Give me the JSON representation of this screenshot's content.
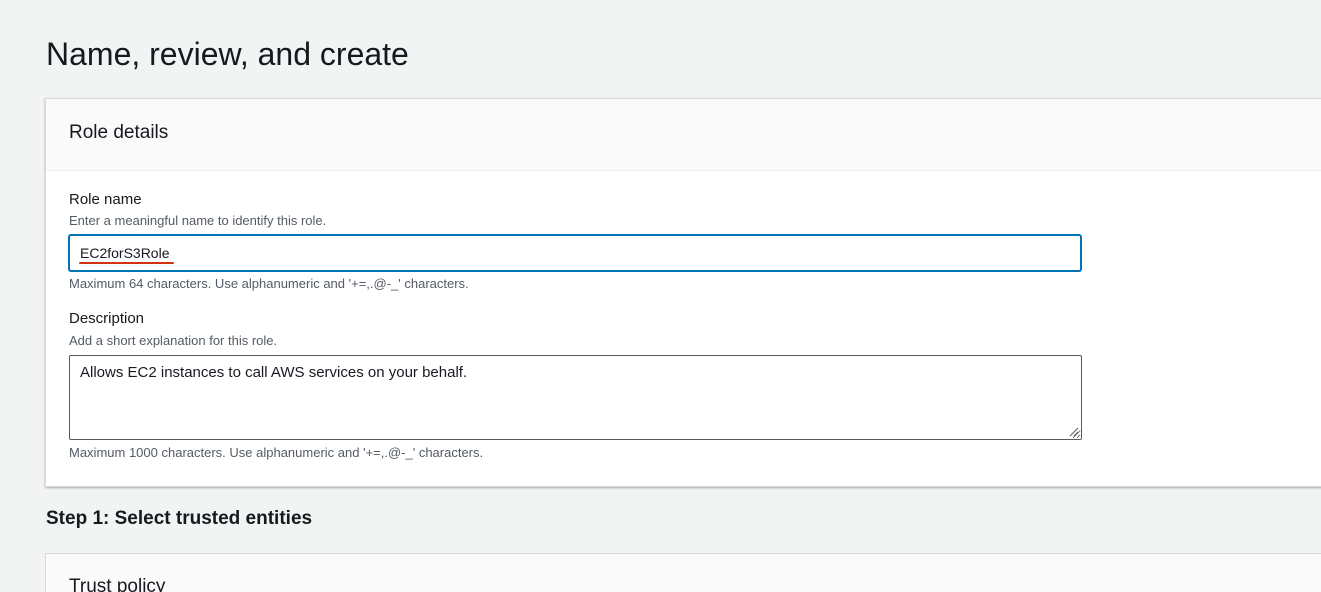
{
  "page": {
    "title": "Name, review, and create"
  },
  "role_details": {
    "header": "Role details",
    "role_name": {
      "label": "Role name",
      "description": "Enter a meaningful name to identify this role.",
      "value": "EC2forS3Role",
      "constraint": "Maximum 64 characters. Use alphanumeric and '+=,.@-_' characters."
    },
    "description_field": {
      "label": "Description",
      "description": "Add a short explanation for this role.",
      "value": "Allows EC2 instances to call AWS services on your behalf.",
      "constraint": "Maximum 1000 characters. Use alphanumeric and '+=,.@-_' characters."
    }
  },
  "step1": {
    "title": "Step 1: Select trusted entities",
    "panel_header": "Trust policy"
  },
  "colors": {
    "focus_border": "#0073bb",
    "spellcheck_underline": "#d13212",
    "background": "#f2f3f3"
  }
}
